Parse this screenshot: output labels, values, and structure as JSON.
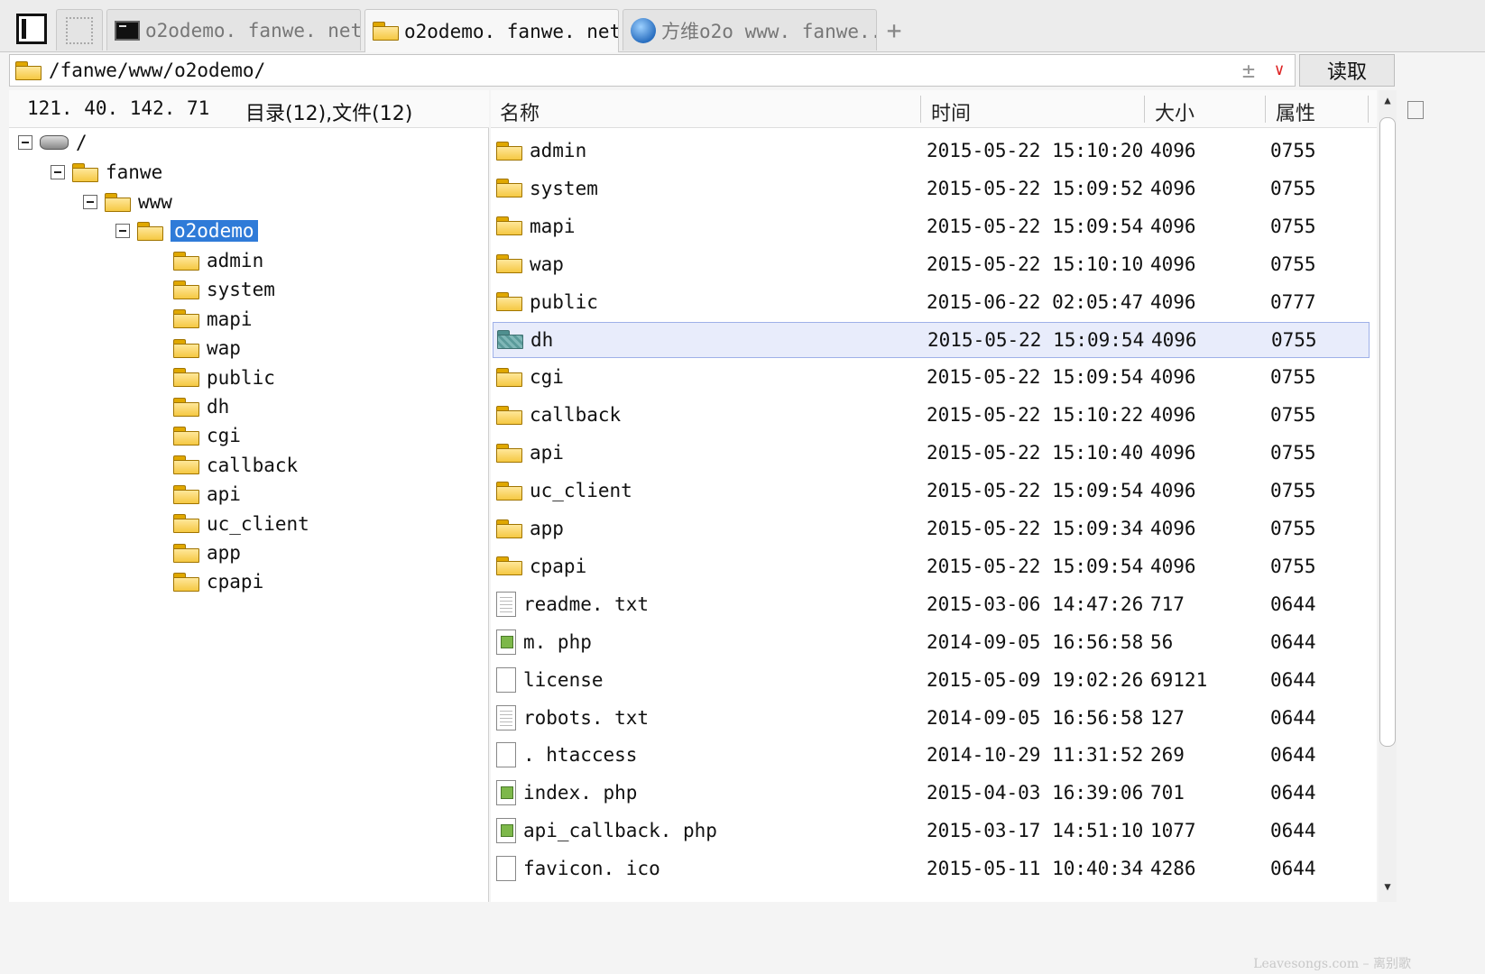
{
  "tabs": [
    {
      "label": "o2odemo. fanwe. net",
      "icon": "terminal-icon"
    },
    {
      "label": "o2odemo. fanwe. net",
      "icon": "folder-icon",
      "active": true
    },
    {
      "label": "方维o2o  www. fanwe...",
      "icon": "globe-icon"
    }
  ],
  "tab_add": "+",
  "address": {
    "path": "/fanwe/www/o2odemo/",
    "up_symbol": "±",
    "dropdown_symbol": "∨",
    "read_label": "读取"
  },
  "left_panel": {
    "host": "121. 40. 142. 71",
    "summary": "目录(12),文件(12)",
    "tree": {
      "root": "/",
      "level1": "fanwe",
      "level2": "www",
      "level3": "o2odemo",
      "children": [
        "admin",
        "system",
        "mapi",
        "wap",
        "public",
        "dh",
        "cgi",
        "callback",
        "api",
        "uc_client",
        "app",
        "cpapi"
      ]
    }
  },
  "file_list": {
    "columns": {
      "name": "名称",
      "time": "时间",
      "size": "大小",
      "attr": "属性"
    },
    "rows": [
      {
        "name": "admin",
        "time": "2015-05-22 15:10:20",
        "size": "4096",
        "attr": "0755",
        "type": "folder"
      },
      {
        "name": "system",
        "time": "2015-05-22 15:09:52",
        "size": "4096",
        "attr": "0755",
        "type": "folder"
      },
      {
        "name": "mapi",
        "time": "2015-05-22 15:09:54",
        "size": "4096",
        "attr": "0755",
        "type": "folder"
      },
      {
        "name": "wap",
        "time": "2015-05-22 15:10:10",
        "size": "4096",
        "attr": "0755",
        "type": "folder"
      },
      {
        "name": "public",
        "time": "2015-06-22 02:05:47",
        "size": "4096",
        "attr": "0777",
        "type": "folder"
      },
      {
        "name": "dh",
        "time": "2015-05-22 15:09:54",
        "size": "4096",
        "attr": "0755",
        "type": "folder-special"
      },
      {
        "name": "cgi",
        "time": "2015-05-22 15:09:54",
        "size": "4096",
        "attr": "0755",
        "type": "folder"
      },
      {
        "name": "callback",
        "time": "2015-05-22 15:10:22",
        "size": "4096",
        "attr": "0755",
        "type": "folder"
      },
      {
        "name": "api",
        "time": "2015-05-22 15:10:40",
        "size": "4096",
        "attr": "0755",
        "type": "folder"
      },
      {
        "name": "uc_client",
        "time": "2015-05-22 15:09:54",
        "size": "4096",
        "attr": "0755",
        "type": "folder"
      },
      {
        "name": "app",
        "time": "2015-05-22 15:09:34",
        "size": "4096",
        "attr": "0755",
        "type": "folder"
      },
      {
        "name": "cpapi",
        "time": "2015-05-22 15:09:54",
        "size": "4096",
        "attr": "0755",
        "type": "folder"
      },
      {
        "name": "readme. txt",
        "time": "2015-03-06 14:47:26",
        "size": "717",
        "attr": "0644",
        "type": "txt"
      },
      {
        "name": "m. php",
        "time": "2014-09-05 16:56:58",
        "size": "56",
        "attr": "0644",
        "type": "php"
      },
      {
        "name": "license",
        "time": "2015-05-09 19:02:26",
        "size": "69121",
        "attr": "0644",
        "type": "file"
      },
      {
        "name": "robots. txt",
        "time": "2014-09-05 16:56:58",
        "size": "127",
        "attr": "0644",
        "type": "txt"
      },
      {
        "name": ". htaccess",
        "time": "2014-10-29 11:31:52",
        "size": "269",
        "attr": "0644",
        "type": "file"
      },
      {
        "name": "index. php",
        "time": "2015-04-03 16:39:06",
        "size": "701",
        "attr": "0644",
        "type": "php"
      },
      {
        "name": "api_callback. php",
        "time": "2015-03-17 14:51:10",
        "size": "1077",
        "attr": "0644",
        "type": "php"
      },
      {
        "name": "favicon. ico",
        "time": "2015-05-11 10:40:34",
        "size": "4286",
        "attr": "0644",
        "type": "file"
      }
    ]
  },
  "watermark": "Leavesongs.com – 离别歌",
  "colors": {
    "selection": "#2f7bd8",
    "row_highlight": "#e8ecfb",
    "dropdown": "#d22222"
  }
}
